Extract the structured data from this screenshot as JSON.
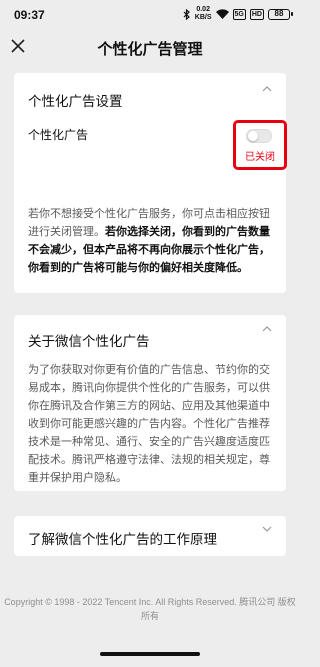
{
  "status_bar": {
    "time": "09:37",
    "speed_value": "0.02",
    "speed_unit": "KB/S",
    "signal_1": "5G",
    "signal_2": "HD",
    "battery": "88"
  },
  "nav": {
    "back_icon": "close-icon",
    "title": "个性化广告管理"
  },
  "ad_settings": {
    "title": "个性化广告设置",
    "toggle_label": "个性化广告",
    "toggle_on": false,
    "toggle_status": "已关闭",
    "highlight_color": "#e60012",
    "desc_normal": "若你不想接受个性化广告服务，你可点击相应按钮进行关闭管理。",
    "desc_bold": "若你选择关闭，你看到的广告数量不会减少，但本产品将不再向你展示个性化广告，你看到的广告将可能与你的偏好相关度降低。"
  },
  "about": {
    "title": "关于微信个性化广告",
    "paragraph": "为了你获取对你更有价值的广告信息、节约你的交易成本，腾讯向你提供个性化的广告服务，可以供你在腾讯及合作第三方的网站、应用及其他渠道中收到你可能更感兴趣的广告内容。个性化广告推荐技术是一种常见、通行、安全的广告兴趣度适度匹配技术。腾讯严格遵守法律、法规的相关规定，尊重并保护用户隐私。"
  },
  "how_it_works": {
    "title": "了解微信个性化广告的工作原理"
  },
  "footer": {
    "copyright": "Copyright © 1998 - 2022 Tencent Inc. All Rights Reserved. 腾讯公司 版权所有"
  }
}
